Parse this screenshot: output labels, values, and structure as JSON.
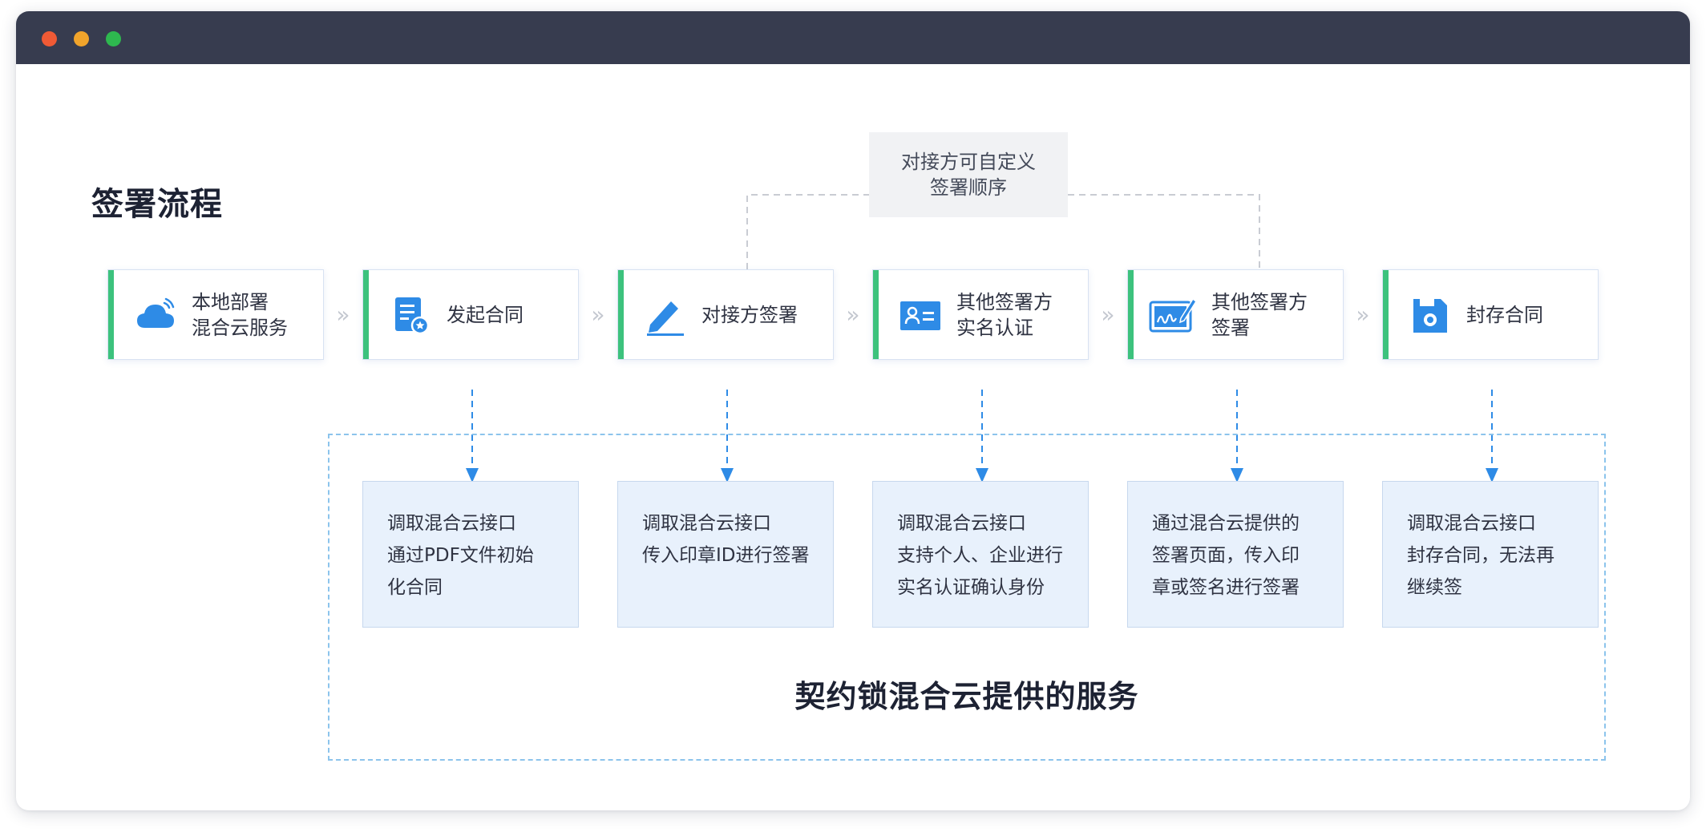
{
  "diagram": {
    "title": "签署流程",
    "note_lines": [
      "对接方可自定义",
      "签署顺序"
    ],
    "steps": [
      {
        "label": "本地部署\n混合云服务",
        "icon": "cloud-icon"
      },
      {
        "label": "发起合同",
        "icon": "document-icon"
      },
      {
        "label": "对接方签署",
        "icon": "pen-icon"
      },
      {
        "label": "其他签署方\n实名认证",
        "icon": "id-card-icon"
      },
      {
        "label": "其他签署方\n签署",
        "icon": "tablet-signature-icon"
      },
      {
        "label": "封存合同",
        "icon": "archive-icon"
      }
    ],
    "descriptions": [
      "调取混合云接口\n通过PDF文件初始\n化合同",
      "调取混合云接口\n传入印章ID进行签署",
      "调取混合云接口\n支持个人、企业进行\n实名认证确认身份",
      "通过混合云提供的\n签署页面，传入印\n章或签名进行签署",
      "调取混合云接口\n封存合同，无法再\n继续签"
    ],
    "service_title": "契约锁混合云提供的服务",
    "chevron": "»",
    "colors": {
      "accent_green": "#3cc27d",
      "icon_blue": "#2e8be6",
      "dashed_blue": "#8cc4ec",
      "desc_bg": "#e8f1fc",
      "titlebar": "#373c4f"
    }
  }
}
